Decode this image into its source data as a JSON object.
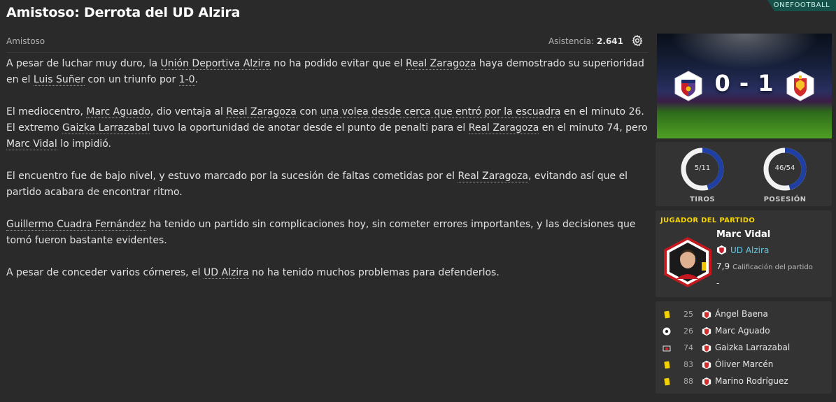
{
  "header": {
    "title": "Amistoso: Derrota del UD Alzira",
    "brand": "ONEFOOTBALL",
    "competition": "Amistoso",
    "attendance_label": "Asistencia:",
    "attendance_value": "2.641"
  },
  "report": {
    "p1": {
      "t1": "A pesar de luchar muy duro, la ",
      "l1": "Unión Deportiva Alzira",
      "t2": " no ha podido evitar que el ",
      "l2": "Real Zaragoza",
      "t3": " haya demostrado su superioridad en el ",
      "l3": "Luis Suñer",
      "t4": " con un triunfo por ",
      "l4": "1-0",
      "t5": "."
    },
    "p2": {
      "t1": "El mediocentro, ",
      "l1": "Marc Aguado",
      "t2": ", dio ventaja al ",
      "l2": "Real Zaragoza",
      "t3": " con ",
      "l3": "una volea desde cerca que entró por la escuadra",
      "t4": " en el minuto 26. El extremo ",
      "l4": "Gaizka Larrazabal",
      "t5": " tuvo la oportunidad de anotar desde el punto de penalti para el ",
      "l5": "Real Zaragoza",
      "t6": " en el minuto 74, pero ",
      "l6": "Marc Vidal",
      "t7": " lo impidió."
    },
    "p3": {
      "t1": "El encuentro fue de bajo nivel, y estuvo marcado por la sucesión de faltas cometidas por el ",
      "l1": "Real Zaragoza",
      "t2": ", evitando así que el partido acabara de encontrar ritmo."
    },
    "p4": {
      "l1": "Guillermo Cuadra Fernández",
      "t1": " ha tenido un partido sin complicaciones hoy, sin cometer errores importantes, y las decisiones que tomó fueron bastante evidentes."
    },
    "p5": {
      "t1": "A pesar de conceder varios córneres, el ",
      "l1": "UD Alzira",
      "t2": " no ha tenido muchos problemas para defenderlos."
    }
  },
  "scoreboard": {
    "score": "0 - 1"
  },
  "stats": {
    "shots": {
      "text": "5/11",
      "home": 5,
      "total": 11,
      "label": "TIROS"
    },
    "possession": {
      "text": "46/54",
      "home": 46,
      "total": 100,
      "label": "POSESIÓN"
    },
    "home_color": "#1f3fa3",
    "away_color": "#f2f2f2"
  },
  "potm": {
    "heading": "JUGADOR DEL PARTIDO",
    "name": "Marc Vidal",
    "team": "UD Alzira",
    "rating": "7,9",
    "rating_label": "Calificación del partido",
    "extra": "-"
  },
  "events": [
    {
      "icon": "yellow-card-icon",
      "minute": "25",
      "player": "Ángel Baena"
    },
    {
      "icon": "goal-ball-icon",
      "minute": "26",
      "player": "Marc Aguado"
    },
    {
      "icon": "missed-penalty-icon",
      "minute": "74",
      "player": "Gaizka Larrazabal"
    },
    {
      "icon": "yellow-card-icon",
      "minute": "83",
      "player": "Óliver Marcén"
    },
    {
      "icon": "yellow-card-icon",
      "minute": "88",
      "player": "Marino Rodríguez"
    }
  ],
  "colors": {
    "background": "#2a2a2a",
    "panel": "#333333",
    "accent_link": "#62c8e3",
    "potm_heading": "#f5d400",
    "brand_bg": "#16524a"
  }
}
